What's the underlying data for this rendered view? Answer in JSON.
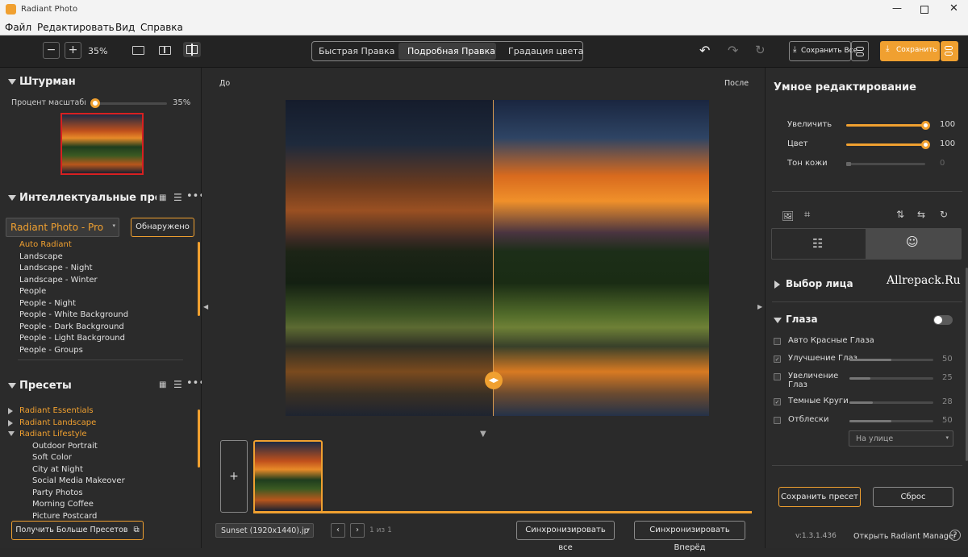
{
  "app": {
    "title": "Radiant Photo",
    "accent": "#f0a030"
  },
  "menu": [
    "Файл",
    "Редактировать",
    "Вид",
    "Справка"
  ],
  "toolbar": {
    "zoom": "35%",
    "tabs": [
      "Быстрая Правка",
      "Подробная Правка",
      "Градация цвета"
    ],
    "active_tab": "Подробная Правка",
    "save_all": "Сохранить Все",
    "save": "Сохранить"
  },
  "navigator": {
    "title": "Штурман",
    "zoom_label": "Процент масштабир",
    "zoom_value": "35%",
    "zoom_fraction": 0.02
  },
  "smart_presets": {
    "title": "Интеллектуальные пресет",
    "selected": "Radiant Photo - Pro",
    "detect_btn": "Обнаружено",
    "items": [
      "Auto Radiant",
      "Landscape",
      "Landscape - Night",
      "Landscape - Winter",
      "People",
      "People - Night",
      "People - White Background",
      "People - Dark Background",
      "People - Light Background",
      "People - Groups"
    ]
  },
  "presets": {
    "title": "Пресеты",
    "groups": [
      "Radiant Essentials",
      "Radiant Landscape",
      "Radiant Lifestyle"
    ],
    "items": [
      "Outdoor Portrait",
      "Soft Color",
      "City at Night",
      "Social Media Makeover",
      "Party Photos",
      "Morning Coffee",
      "Picture Postcard"
    ],
    "more_btn": "Получить Больше Пресетов"
  },
  "compare": {
    "before": "До",
    "after": "После"
  },
  "filmstrip": {
    "add": "+",
    "filename": "Sunset (1920x1440).jp",
    "page": "1 из 1",
    "sync_all": "Синхронизировать все",
    "sync_forward": "Синхронизировать Вперёд"
  },
  "smart_edit": {
    "title": "Умное редактирование",
    "sliders": [
      {
        "label": "Увеличить",
        "value": "100",
        "fraction": 1.0
      },
      {
        "label": "Цвет",
        "value": "100",
        "fraction": 1.0
      },
      {
        "label": "Тон кожи",
        "value": "0",
        "fraction": 0.0
      }
    ]
  },
  "face": {
    "title": "Выбор лица",
    "watermark": "Allrepack.Ru"
  },
  "eyes": {
    "title": "Глаза",
    "rows": [
      {
        "label": "Авто Красные Глаза",
        "value": "",
        "fraction": null
      },
      {
        "label": "Улучшение Глаз",
        "value": "50",
        "fraction": 0.5
      },
      {
        "label": "Увеличение",
        "label2": "Глаз",
        "value": "25",
        "fraction": 0.25
      },
      {
        "label": "Темные Круги",
        "value": "28",
        "fraction": 0.28
      },
      {
        "label": "Отблески",
        "value": "50",
        "fraction": 0.5
      }
    ],
    "select": "На улице"
  },
  "footer": {
    "save_preset": "Сохранить пресет",
    "reset": "Сброс",
    "version": "v:1.3.1.436",
    "open_manager": "Открыть Radiant Manager"
  }
}
